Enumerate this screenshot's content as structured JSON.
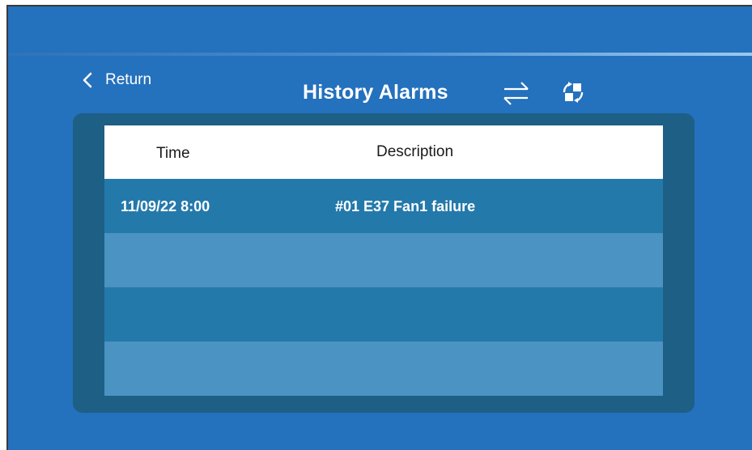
{
  "header": {
    "return_label": "Return",
    "title": "History Alarms",
    "icons": {
      "back": "chevron-left-icon",
      "swap": "swap-arrows-icon",
      "rotate": "rotate-icon"
    }
  },
  "table": {
    "columns": [
      "Time",
      "Description"
    ],
    "rows": [
      {
        "time": "11/09/22 8:00",
        "description": "#01 E37 Fan1 failure"
      },
      {
        "time": "",
        "description": ""
      },
      {
        "time": "",
        "description": ""
      },
      {
        "time": "",
        "description": ""
      }
    ]
  },
  "colors": {
    "background": "#2471bd",
    "panel": "#1e5f86",
    "row_dark": "#2479ab",
    "row_light": "#4b93c2",
    "header_bg": "#ffffff"
  }
}
